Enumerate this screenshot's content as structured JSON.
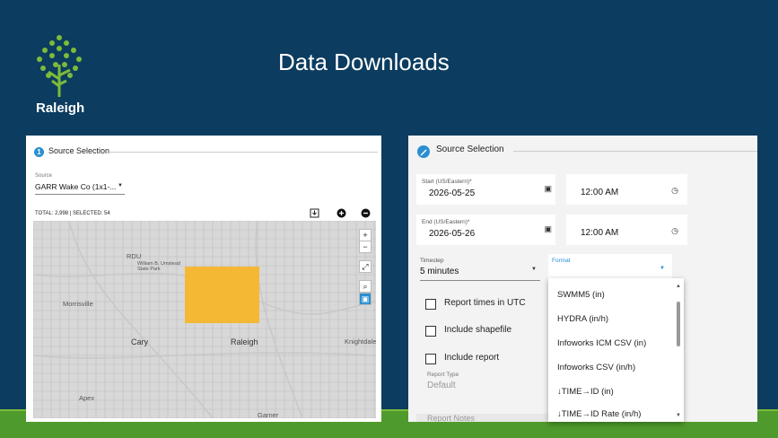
{
  "header": {
    "title": "Data Downloads",
    "logo_text": "Raleigh"
  },
  "left_panel": {
    "step_number": "1",
    "title": "Source Selection",
    "source": {
      "label": "Source",
      "value": "GARR Wake Co (1x1-..."
    },
    "totals_text": "TOTAL: 2,998 | SELECTED: 54",
    "map_labels": {
      "rdu": "RDU",
      "state_park": "William B. Umstead State Park",
      "morrisville": "Morrisville",
      "cary": "Cary",
      "raleigh": "Raleigh",
      "knightdale": "Knightdale",
      "apex": "Apex",
      "garner": "Garner"
    },
    "zoom_in": "+",
    "zoom_out": "−"
  },
  "right_panel": {
    "title": "Source Selection",
    "start": {
      "label": "Start (US/Eastern)*",
      "date": "2026-05-25",
      "time": "12:00 AM"
    },
    "end": {
      "label": "End (US/Eastern)*",
      "date": "2026-05-26",
      "time": "12:00 AM"
    },
    "timestep": {
      "label": "Timestep",
      "value": "5 minutes"
    },
    "format": {
      "label": "Format",
      "value": ""
    },
    "checkboxes": [
      "Report times in UTC",
      "Include shapefile",
      "Include report"
    ],
    "report_type": {
      "label": "Report Type",
      "value": "Default"
    },
    "report_notes": "Report Notes",
    "format_options": [
      "SWMM5 (in)",
      "HYDRA (in/h)",
      "Infoworks ICM CSV (in)",
      "Infoworks CSV (in/h)",
      "↓TIME→ID (in)",
      "↓TIME→ID Rate (in/h)"
    ]
  }
}
